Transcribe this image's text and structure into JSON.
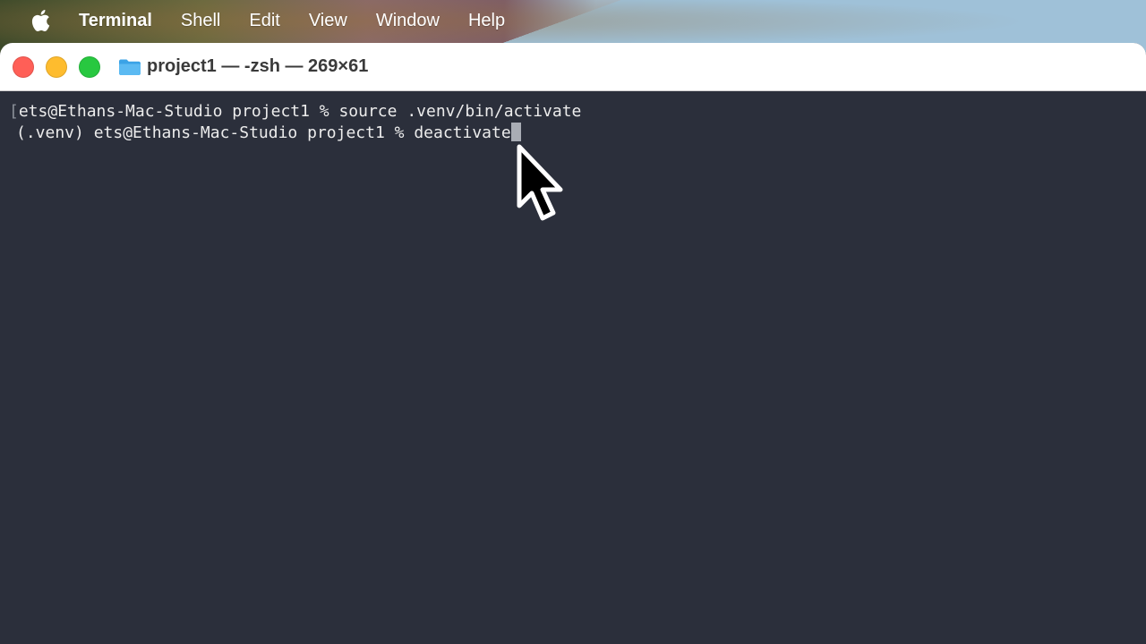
{
  "menubar": {
    "apple_icon": "apple-logo-icon",
    "app_name": "Terminal",
    "items": [
      "Shell",
      "Edit",
      "View",
      "Window",
      "Help"
    ]
  },
  "window": {
    "title": "project1 — -zsh — 269×61",
    "traffic_lights": {
      "close_color": "#ff5f57",
      "minimize_color": "#febc2e",
      "maximize_color": "#28c840"
    },
    "folder_icon": "folder-icon"
  },
  "terminal": {
    "background": "#2b2f3b",
    "lines": [
      {
        "bracket": "[",
        "text": "ets@Ethans-Mac-Studio project1 % source .venv/bin/activate"
      },
      {
        "text": "(.venv) ets@Ethans-Mac-Studio project1 % deactivate"
      }
    ]
  },
  "cursor": {
    "icon": "mouse-pointer-icon"
  }
}
